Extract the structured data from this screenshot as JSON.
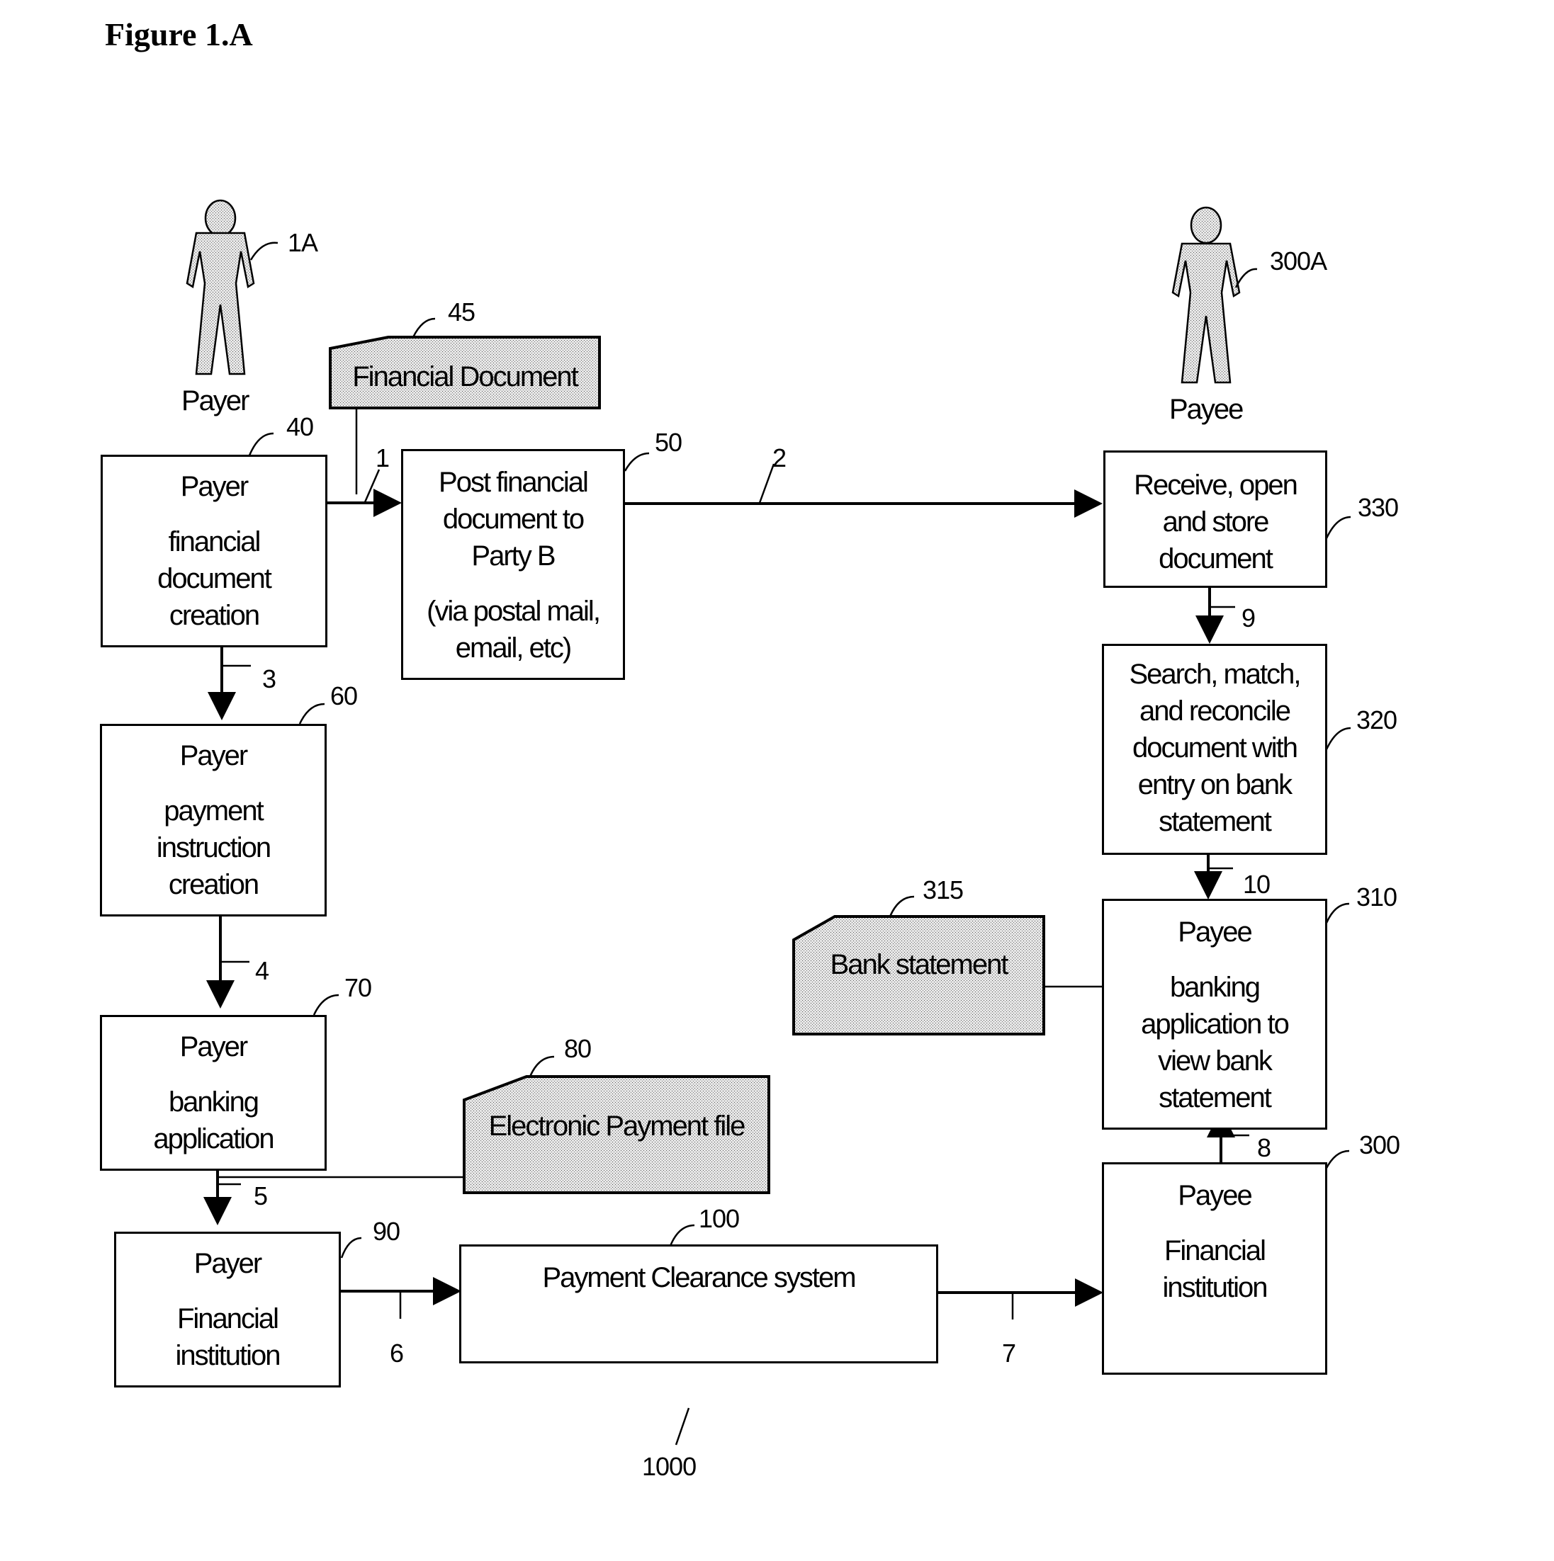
{
  "figure": {
    "title": "Figure 1.A",
    "ref": "1000"
  },
  "actors": {
    "payer": {
      "label": "Payer",
      "ref": "1A"
    },
    "payee": {
      "label": "Payee",
      "ref": "300A"
    }
  },
  "documents": {
    "financial_document": {
      "label": "Financial Document",
      "ref": "45"
    },
    "electronic_payment_file": {
      "label": "Electronic Payment file",
      "ref": "80"
    },
    "bank_statement": {
      "label": "Bank statement",
      "ref": "315"
    }
  },
  "boxes": {
    "b40": {
      "ref": "40",
      "title": "Payer",
      "lines": [
        "financial",
        "document",
        "creation"
      ]
    },
    "b50": {
      "ref": "50",
      "title": "Post financial",
      "lines": [
        "document to",
        "Party B",
        "",
        "(via postal mail,",
        "email, etc)"
      ]
    },
    "b60": {
      "ref": "60",
      "title": "Payer",
      "lines": [
        "payment",
        "instruction",
        "creation"
      ]
    },
    "b70": {
      "ref": "70",
      "title": "Payer",
      "lines": [
        "banking",
        "application"
      ]
    },
    "b90": {
      "ref": "90",
      "title": "Payer",
      "lines": [
        "Financial",
        "institution"
      ]
    },
    "b100": {
      "ref": "100",
      "title": "Payment Clearance system",
      "lines": []
    },
    "b300": {
      "ref": "300",
      "title": "Payee",
      "lines": [
        "Financial",
        "institution"
      ]
    },
    "b310": {
      "ref": "310",
      "title": "Payee",
      "lines": [
        "banking",
        "application to",
        "view bank",
        "statement"
      ]
    },
    "b320": {
      "ref": "320",
      "title": "Search, match,",
      "lines": [
        "and reconcile",
        "document with",
        "entry on bank",
        "statement"
      ]
    },
    "b330": {
      "ref": "330",
      "title": "Receive, open",
      "lines": [
        "and store",
        "document"
      ]
    }
  },
  "flows": {
    "f1": "1",
    "f2": "2",
    "f3": "3",
    "f4": "4",
    "f5": "5",
    "f6": "6",
    "f7": "7",
    "f8": "8",
    "f9": "9",
    "f10": "10"
  },
  "colors": {
    "line": "#000000",
    "doc_fill": "#c8c8c8",
    "figure_fill": "#d8d8d8"
  }
}
